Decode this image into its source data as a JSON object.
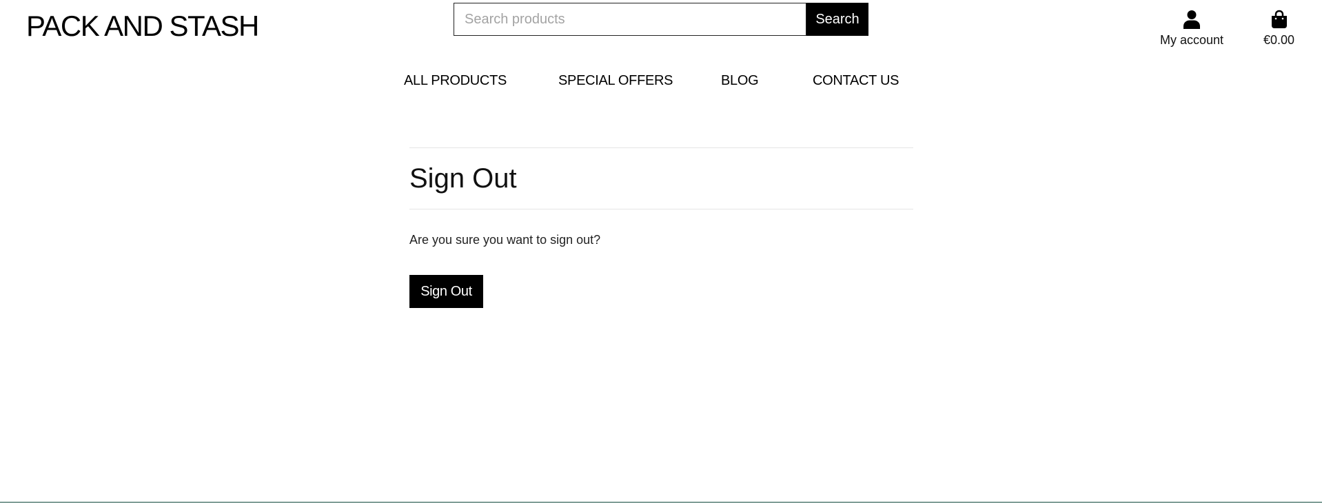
{
  "header": {
    "logo": "PACK AND STASH",
    "search_placeholder": "Search products",
    "search_button": "Search",
    "account_label": "My account",
    "account_icon": "user-icon",
    "cart_total": "€0.00",
    "cart_icon": "shopping-bag-icon"
  },
  "nav": {
    "items": [
      "ALL PRODUCTS",
      "SPECIAL OFFERS",
      "BLOG",
      "CONTACT US"
    ]
  },
  "main": {
    "title": "Sign Out",
    "message": "Are you sure you want to sign out?",
    "button": "Sign Out"
  },
  "colors": {
    "accent": "#000000",
    "footer_line": "#7f9d96"
  }
}
